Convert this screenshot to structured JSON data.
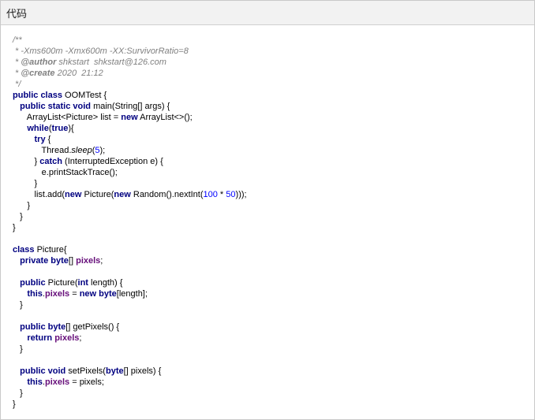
{
  "header": {
    "title": "代码"
  },
  "code_lines": [
    [
      [
        "/**",
        "cmt"
      ]
    ],
    [
      [
        " * -Xms600m -Xmx600m -XX:SurvivorRatio=8",
        "cmt"
      ]
    ],
    [
      [
        " * ",
        "cmt"
      ],
      [
        "@author",
        "doc"
      ],
      [
        " shkstart  shkstart@126.com",
        "cmt"
      ]
    ],
    [
      [
        " * ",
        "cmt"
      ],
      [
        "@create",
        "doc"
      ],
      [
        " 2020  21:12",
        "cmt"
      ]
    ],
    [
      [
        " */",
        "cmt"
      ]
    ],
    [
      [
        "public class",
        "kw"
      ],
      [
        " OOMTest {",
        "pln"
      ]
    ],
    [
      [
        "   ",
        "pln"
      ],
      [
        "public static void",
        "kw"
      ],
      [
        " main(String[] args) {",
        "pln"
      ]
    ],
    [
      [
        "      ArrayList<Picture> list = ",
        "pln"
      ],
      [
        "new",
        "kw"
      ],
      [
        " ArrayList<>();",
        "pln"
      ]
    ],
    [
      [
        "      ",
        "pln"
      ],
      [
        "while",
        "kw"
      ],
      [
        "(",
        "pln"
      ],
      [
        "true",
        "kw"
      ],
      [
        "){",
        "pln"
      ]
    ],
    [
      [
        "         ",
        "pln"
      ],
      [
        "try",
        "kw"
      ],
      [
        " {",
        "pln"
      ]
    ],
    [
      [
        "            Thread.",
        "pln"
      ],
      [
        "sleep",
        "itl"
      ],
      [
        "(",
        "pln"
      ],
      [
        "5",
        "num"
      ],
      [
        ");",
        "pln"
      ]
    ],
    [
      [
        "         } ",
        "pln"
      ],
      [
        "catch",
        "kw"
      ],
      [
        " (InterruptedException e) {",
        "pln"
      ]
    ],
    [
      [
        "            e.printStackTrace();",
        "pln"
      ]
    ],
    [
      [
        "         }",
        "pln"
      ]
    ],
    [
      [
        "         list.add(",
        "pln"
      ],
      [
        "new",
        "kw"
      ],
      [
        " Picture(",
        "pln"
      ],
      [
        "new",
        "kw"
      ],
      [
        " Random().nextInt(",
        "pln"
      ],
      [
        "100",
        "num"
      ],
      [
        " * ",
        "pln"
      ],
      [
        "50",
        "num"
      ],
      [
        ")));",
        "pln"
      ]
    ],
    [
      [
        "      }",
        "pln"
      ]
    ],
    [
      [
        "   }",
        "pln"
      ]
    ],
    [
      [
        "}",
        "pln"
      ]
    ],
    [
      [
        "",
        "pln"
      ]
    ],
    [
      [
        "class",
        "kw"
      ],
      [
        " Picture{",
        "pln"
      ]
    ],
    [
      [
        "   ",
        "pln"
      ],
      [
        "private byte",
        "kw"
      ],
      [
        "[] ",
        "pln"
      ],
      [
        "pixels",
        "fld"
      ],
      [
        ";",
        "pln"
      ]
    ],
    [
      [
        "",
        "pln"
      ]
    ],
    [
      [
        "   ",
        "pln"
      ],
      [
        "public",
        "kw"
      ],
      [
        " Picture(",
        "pln"
      ],
      [
        "int",
        "kw"
      ],
      [
        " length) {",
        "pln"
      ]
    ],
    [
      [
        "      ",
        "pln"
      ],
      [
        "this",
        "kw"
      ],
      [
        ".",
        "pln"
      ],
      [
        "pixels",
        "fld"
      ],
      [
        " = ",
        "pln"
      ],
      [
        "new byte",
        "kw"
      ],
      [
        "[length];",
        "pln"
      ]
    ],
    [
      [
        "   }",
        "pln"
      ]
    ],
    [
      [
        "",
        "pln"
      ]
    ],
    [
      [
        "   ",
        "pln"
      ],
      [
        "public byte",
        "kw"
      ],
      [
        "[] getPixels() {",
        "pln"
      ]
    ],
    [
      [
        "      ",
        "pln"
      ],
      [
        "return",
        "kw"
      ],
      [
        " ",
        "pln"
      ],
      [
        "pixels",
        "fld"
      ],
      [
        ";",
        "pln"
      ]
    ],
    [
      [
        "   }",
        "pln"
      ]
    ],
    [
      [
        "",
        "pln"
      ]
    ],
    [
      [
        "   ",
        "pln"
      ],
      [
        "public void",
        "kw"
      ],
      [
        " setPixels(",
        "pln"
      ],
      [
        "byte",
        "kw"
      ],
      [
        "[] pixels) {",
        "pln"
      ]
    ],
    [
      [
        "      ",
        "pln"
      ],
      [
        "this",
        "kw"
      ],
      [
        ".",
        "pln"
      ],
      [
        "pixels",
        "fld"
      ],
      [
        " = pixels;",
        "pln"
      ]
    ],
    [
      [
        "   }",
        "pln"
      ]
    ],
    [
      [
        "}",
        "pln"
      ]
    ]
  ]
}
